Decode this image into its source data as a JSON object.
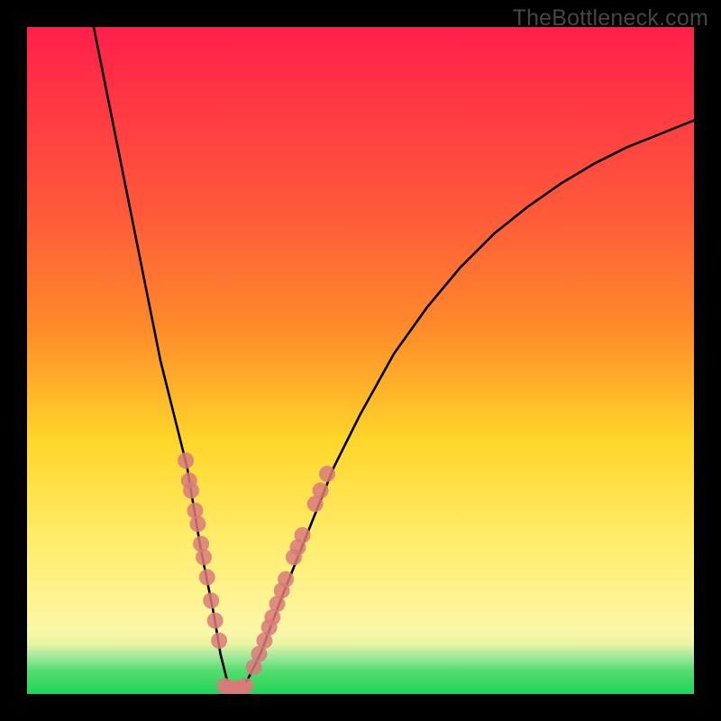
{
  "watermark": "TheBottleneck.com",
  "palette": {
    "gradient_top": "#ff1f4a",
    "gradient_mid_upper": "#ff8a2a",
    "gradient_mid": "#ffd62a",
    "gradient_mid_lower": "#fff59b",
    "gradient_band_yellow": "#faf7a8",
    "gradient_band_green_light": "#9ee89a",
    "gradient_bottom": "#1fd655",
    "curve": "#000000",
    "marker_fill": "#d97a7a",
    "marker_stroke": "#c86a6a"
  },
  "chart_data": {
    "type": "line",
    "title": "",
    "xlabel": "",
    "ylabel": "",
    "xlim": [
      0,
      100
    ],
    "ylim": [
      0,
      100
    ],
    "series": [
      {
        "name": "bottleneck-curve",
        "x": [
          10,
          12,
          14,
          16,
          18,
          20,
          22,
          24,
          26,
          28,
          29,
          30,
          31,
          32,
          33,
          35,
          38,
          42,
          46,
          50,
          55,
          60,
          65,
          70,
          75,
          80,
          85,
          90,
          95,
          100
        ],
        "y": [
          100,
          90,
          80,
          70,
          60,
          50,
          42,
          34,
          22,
          12,
          6,
          2,
          1,
          1,
          2,
          6,
          14,
          24,
          34,
          42,
          51,
          58,
          64,
          69,
          73,
          76.5,
          79.5,
          82,
          84,
          86
        ]
      }
    ],
    "markers": [
      {
        "name": "left-cluster",
        "points": [
          {
            "x": 23.8,
            "y": 35.0
          },
          {
            "x": 24.3,
            "y": 32.0
          },
          {
            "x": 24.6,
            "y": 30.5
          },
          {
            "x": 25.2,
            "y": 27.5
          },
          {
            "x": 25.6,
            "y": 25.5
          },
          {
            "x": 26.1,
            "y": 22.5
          },
          {
            "x": 26.5,
            "y": 20.5
          },
          {
            "x": 27.0,
            "y": 17.5
          },
          {
            "x": 27.6,
            "y": 14.0
          },
          {
            "x": 28.2,
            "y": 11.0
          },
          {
            "x": 28.8,
            "y": 8.0
          }
        ]
      },
      {
        "name": "right-cluster",
        "points": [
          {
            "x": 34.0,
            "y": 4.0
          },
          {
            "x": 34.8,
            "y": 6.0
          },
          {
            "x": 35.6,
            "y": 8.0
          },
          {
            "x": 36.3,
            "y": 10.0
          },
          {
            "x": 36.8,
            "y": 11.5
          },
          {
            "x": 37.5,
            "y": 13.5
          },
          {
            "x": 38.2,
            "y": 15.5
          },
          {
            "x": 38.8,
            "y": 17.2
          },
          {
            "x": 40.0,
            "y": 20.5
          },
          {
            "x": 40.6,
            "y": 22.0
          },
          {
            "x": 41.3,
            "y": 23.8
          },
          {
            "x": 43.2,
            "y": 28.5
          },
          {
            "x": 44.0,
            "y": 30.5
          },
          {
            "x": 45.0,
            "y": 33.0
          }
        ]
      },
      {
        "name": "bottom-cluster",
        "points": [
          {
            "x": 29.6,
            "y": 1.2
          },
          {
            "x": 30.4,
            "y": 0.9
          },
          {
            "x": 31.2,
            "y": 0.8
          },
          {
            "x": 32.0,
            "y": 0.9
          },
          {
            "x": 32.8,
            "y": 1.2
          }
        ]
      }
    ]
  }
}
